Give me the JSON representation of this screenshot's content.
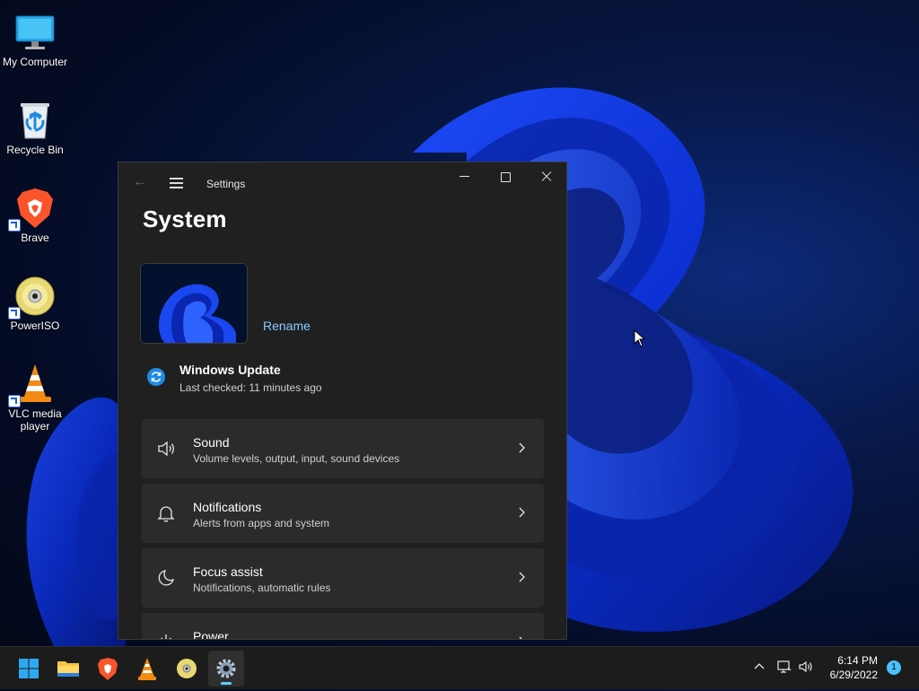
{
  "desktop": {
    "icons": [
      {
        "label": "My Computer",
        "icon": "monitor-icon"
      },
      {
        "label": "Recycle Bin",
        "icon": "recycle-bin-icon"
      },
      {
        "label": "Brave",
        "icon": "brave-icon"
      },
      {
        "label": "PowerISO",
        "icon": "poweriso-disc-icon"
      },
      {
        "label": "VLC media player",
        "icon": "vlc-cone-icon"
      }
    ]
  },
  "settings": {
    "window_title": "Settings",
    "page_title": "System",
    "rename_label": "Rename",
    "windows_update": {
      "title": "Windows Update",
      "subtitle": "Last checked: 11 minutes ago"
    },
    "items": [
      {
        "title": "Sound",
        "subtitle": "Volume levels, output, input, sound devices",
        "icon": "speaker-icon"
      },
      {
        "title": "Notifications",
        "subtitle": "Alerts from apps and system",
        "icon": "bell-icon"
      },
      {
        "title": "Focus assist",
        "subtitle": "Notifications, automatic rules",
        "icon": "moon-icon"
      },
      {
        "title": "Power",
        "subtitle": "",
        "icon": "power-icon"
      }
    ]
  },
  "taskbar": {
    "apps": [
      "start-button",
      "file-explorer",
      "brave",
      "vlc",
      "poweriso",
      "settings"
    ],
    "active_app": "settings",
    "clock": {
      "time": "6:14 PM",
      "date": "6/29/2022"
    },
    "notification_count": "1"
  },
  "colors": {
    "accent": "#60cdff",
    "link": "#88c8ff",
    "window_bg": "#202020",
    "card_bg": "#2b2b2b"
  }
}
